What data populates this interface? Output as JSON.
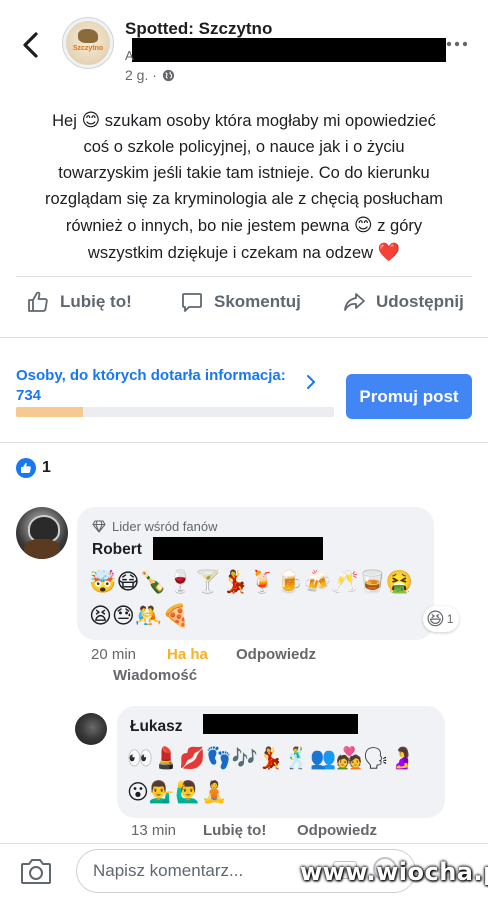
{
  "header": {
    "page_name": "Spotted: Szczytno",
    "logo_text": "Szczytno",
    "author_initial": "A",
    "time": "2 g. ·"
  },
  "post": {
    "line1_a": "Hej ",
    "line1_b": " szukam osoby która mogłaby mi opowiedzieć",
    "line2": "coś o szkole policyjnej, o nauce jak i o życiu",
    "line3": "towarzyskim jeśli takie tam istnieje. Co do kierunku",
    "line4": "rozglądam się za kryminologia ale z chęcią posłucham",
    "line5_a": "również o innych, bo nie jestem pewna ",
    "line5_b": " z góry",
    "line6_a": "wszystkim dziękuje i czekam na odzew ",
    "emoji_smile": "😊",
    "emoji_heart": "❤️"
  },
  "actions": {
    "like": "Lubię to!",
    "comment": "Skomentuj",
    "share": "Udostępnij"
  },
  "promotion": {
    "reach_label": "Osoby, do których dotarła informacja:",
    "reach_count": "734",
    "progress": 0.21,
    "promote_button": "Promuj post"
  },
  "reactions_summary": {
    "count": "1"
  },
  "comments": [
    {
      "badge": "Lider wśród fanów",
      "name": "Robert",
      "emojis_row1": "🤯😷🍾🍷🍸💃🍹🍺🍻🥂🥃🤮",
      "emojis_row2": "😫😓🤼🍕",
      "reaction_emoji": "😆",
      "reaction_count": "1",
      "time": "20 min",
      "reaction_label": "Ha ha",
      "reply": "Odpowiedz",
      "message": "Wiadomość"
    },
    {
      "name": "Łukasz",
      "emojis_row1": "👀💄💋👣🎶💃🕺👥💑🗣🤰",
      "emojis_row2": "😮💁‍♂️🙋‍♂️🧘",
      "time": "13 min",
      "like": "Lubię to!",
      "reply": "Odpowiedz"
    }
  ],
  "composer": {
    "placeholder": "Napisz komentarz...",
    "gif_label": "GIF"
  },
  "watermark": "www.wiocha.pl",
  "colors": {
    "accent": "#1877f2",
    "promote_button": "#4285f4",
    "haha": "#f7b125",
    "progress_fill": "#f5c98f"
  }
}
